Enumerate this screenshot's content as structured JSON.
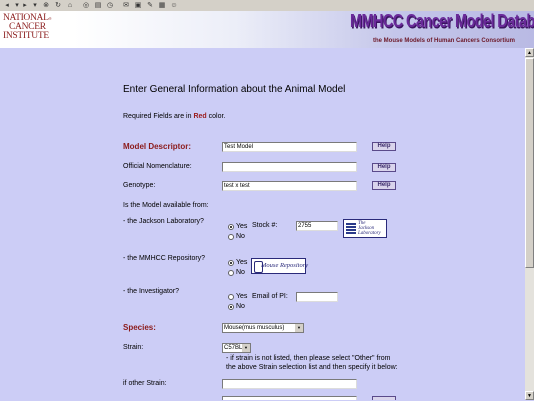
{
  "toolbar": {
    "icons": [
      "back-icon",
      "forward-icon",
      "stop-icon",
      "refresh-icon",
      "home-icon",
      "search-icon",
      "favorites-icon",
      "history-icon",
      "mail-icon",
      "print-icon",
      "edit-icon",
      "discuss-icon",
      "messenger-icon"
    ]
  },
  "banner": {
    "nci_line1": "NATIONAL",
    "nci_sup": "®",
    "nci_line2": "CANCER",
    "nci_line3": "INSTITUTE",
    "title": "MMHCC  Cancer Model Database",
    "subtitle": "the Mouse Models of Human Cancers Consortium"
  },
  "page": {
    "heading": "Enter General Information about the Animal Model",
    "required_prefix": "Required Fields are in ",
    "required_red": "Red",
    "required_suffix": " color."
  },
  "form": {
    "model_descriptor": {
      "label": "Model Descriptor:",
      "value": "Test Model"
    },
    "official_nomenclature": {
      "label": "Official Nomenclature:",
      "value": ""
    },
    "genotype": {
      "label": "Genotype:",
      "value": "test x test"
    },
    "help_label": "Help",
    "availability_question": "Is the Model available from:",
    "jackson": {
      "label": "- the Jackson Laboratory?",
      "yes": "Yes",
      "no": "No",
      "stock_label": "Stock #:",
      "stock_value": "2755",
      "logo_line1": "The",
      "logo_line2": "Jackson",
      "logo_line3": "Laboratory",
      "selected": "yes"
    },
    "mmhcc": {
      "label": "- the MMHCC Repository?",
      "yes": "Yes",
      "no": "No",
      "logo_text": "Mouse Repository",
      "selected": "yes"
    },
    "investigator": {
      "label": "- the Investigator?",
      "yes": "Yes",
      "no": "No",
      "email_label": "Email of PI:",
      "email_value": "",
      "selected": "no"
    },
    "species": {
      "label": "Species:",
      "value": "Mouse(mus musculus)"
    },
    "strain": {
      "label": "Strain:",
      "value": "C57BL/6",
      "note_line1": "- if strain is not listed, then please select \"Other\" from",
      "note_line2": "the above Strain selection list and then specify it below:"
    },
    "other_strain": {
      "label": "if other Strain:",
      "value": ""
    }
  },
  "colors": {
    "background": "#cccdf6",
    "required": "#8b1a1a",
    "title": "#6a2a9a"
  }
}
